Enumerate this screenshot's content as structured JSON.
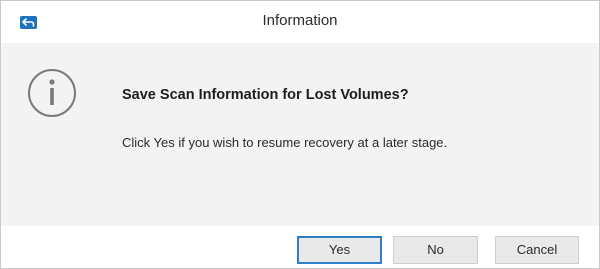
{
  "window": {
    "title": "Information",
    "app_icon": "back-arrow-icon",
    "app_icon_color": "#1e73be"
  },
  "dialog": {
    "icon": "info-circle-icon",
    "heading": "Save Scan Information for Lost Volumes?",
    "message": "Click Yes if you wish to resume recovery at a later stage."
  },
  "buttons": {
    "yes_label": "Yes",
    "no_label": "No",
    "cancel_label": "Cancel",
    "default_button": "Yes"
  },
  "colors": {
    "body_background": "#f3f3f3",
    "focus_border": "#2e7fc8",
    "button_background": "#e9e9e9"
  }
}
